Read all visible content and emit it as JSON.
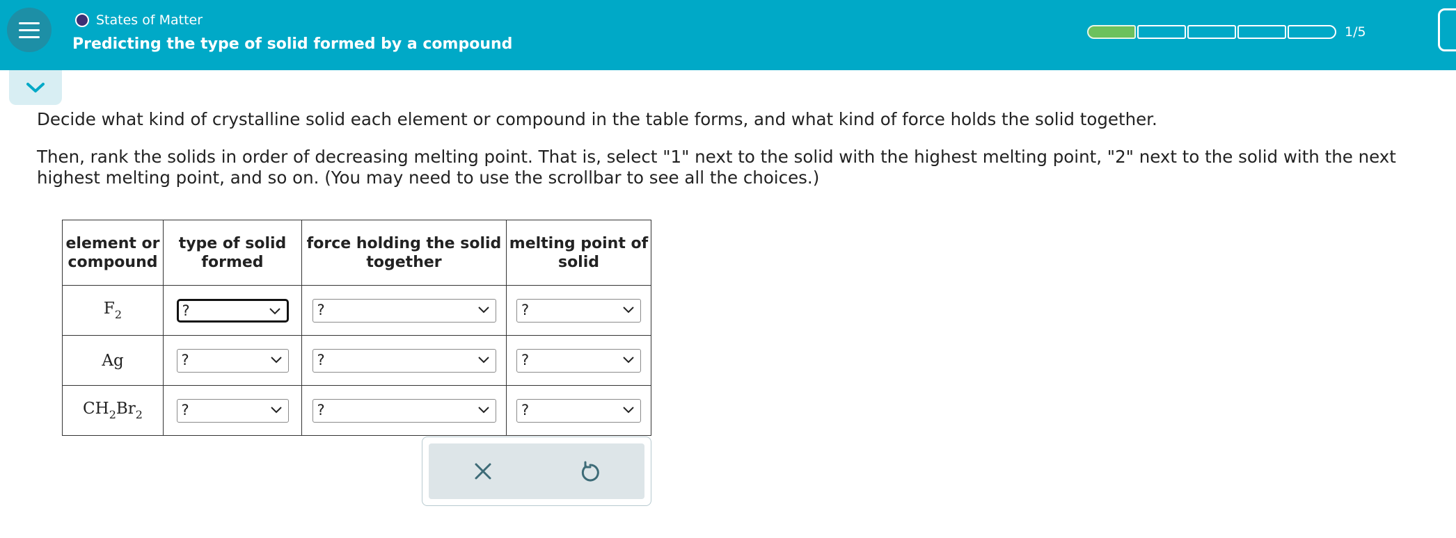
{
  "header": {
    "topic": "States of Matter",
    "title": "Predicting the type of solid formed by a compound",
    "progress": {
      "completed": 1,
      "total": 5,
      "label": "1/5"
    },
    "colors": {
      "bar": "#00a9c7",
      "progress_fill": "#6cc15d",
      "topic_dot": "#3c2f73"
    }
  },
  "instructions": {
    "line1": "Decide what kind of crystalline solid each element or compound in the table forms, and what kind of force holds the solid together.",
    "line2": "Then, rank the solids in order of decreasing melting point. That is, select \"1\" next to the solid with the highest melting point, \"2\" next to the solid with the next highest melting point, and so on. (You may need to use the scrollbar to see all the choices.)"
  },
  "table": {
    "headers": [
      "element or compound",
      "type of solid formed",
      "force holding the solid together",
      "melting point of solid"
    ],
    "rows": [
      {
        "formula_parts": [
          "F",
          "2"
        ],
        "type": "?",
        "force": "?",
        "melting": "?"
      },
      {
        "formula_parts": [
          "Ag"
        ],
        "type": "?",
        "force": "?",
        "melting": "?"
      },
      {
        "formula_parts": [
          "CH",
          "2",
          "Br",
          "2"
        ],
        "type": "?",
        "force": "?",
        "melting": "?"
      }
    ]
  },
  "actions": {
    "clear_icon": "close-icon",
    "undo_icon": "undo-icon"
  }
}
